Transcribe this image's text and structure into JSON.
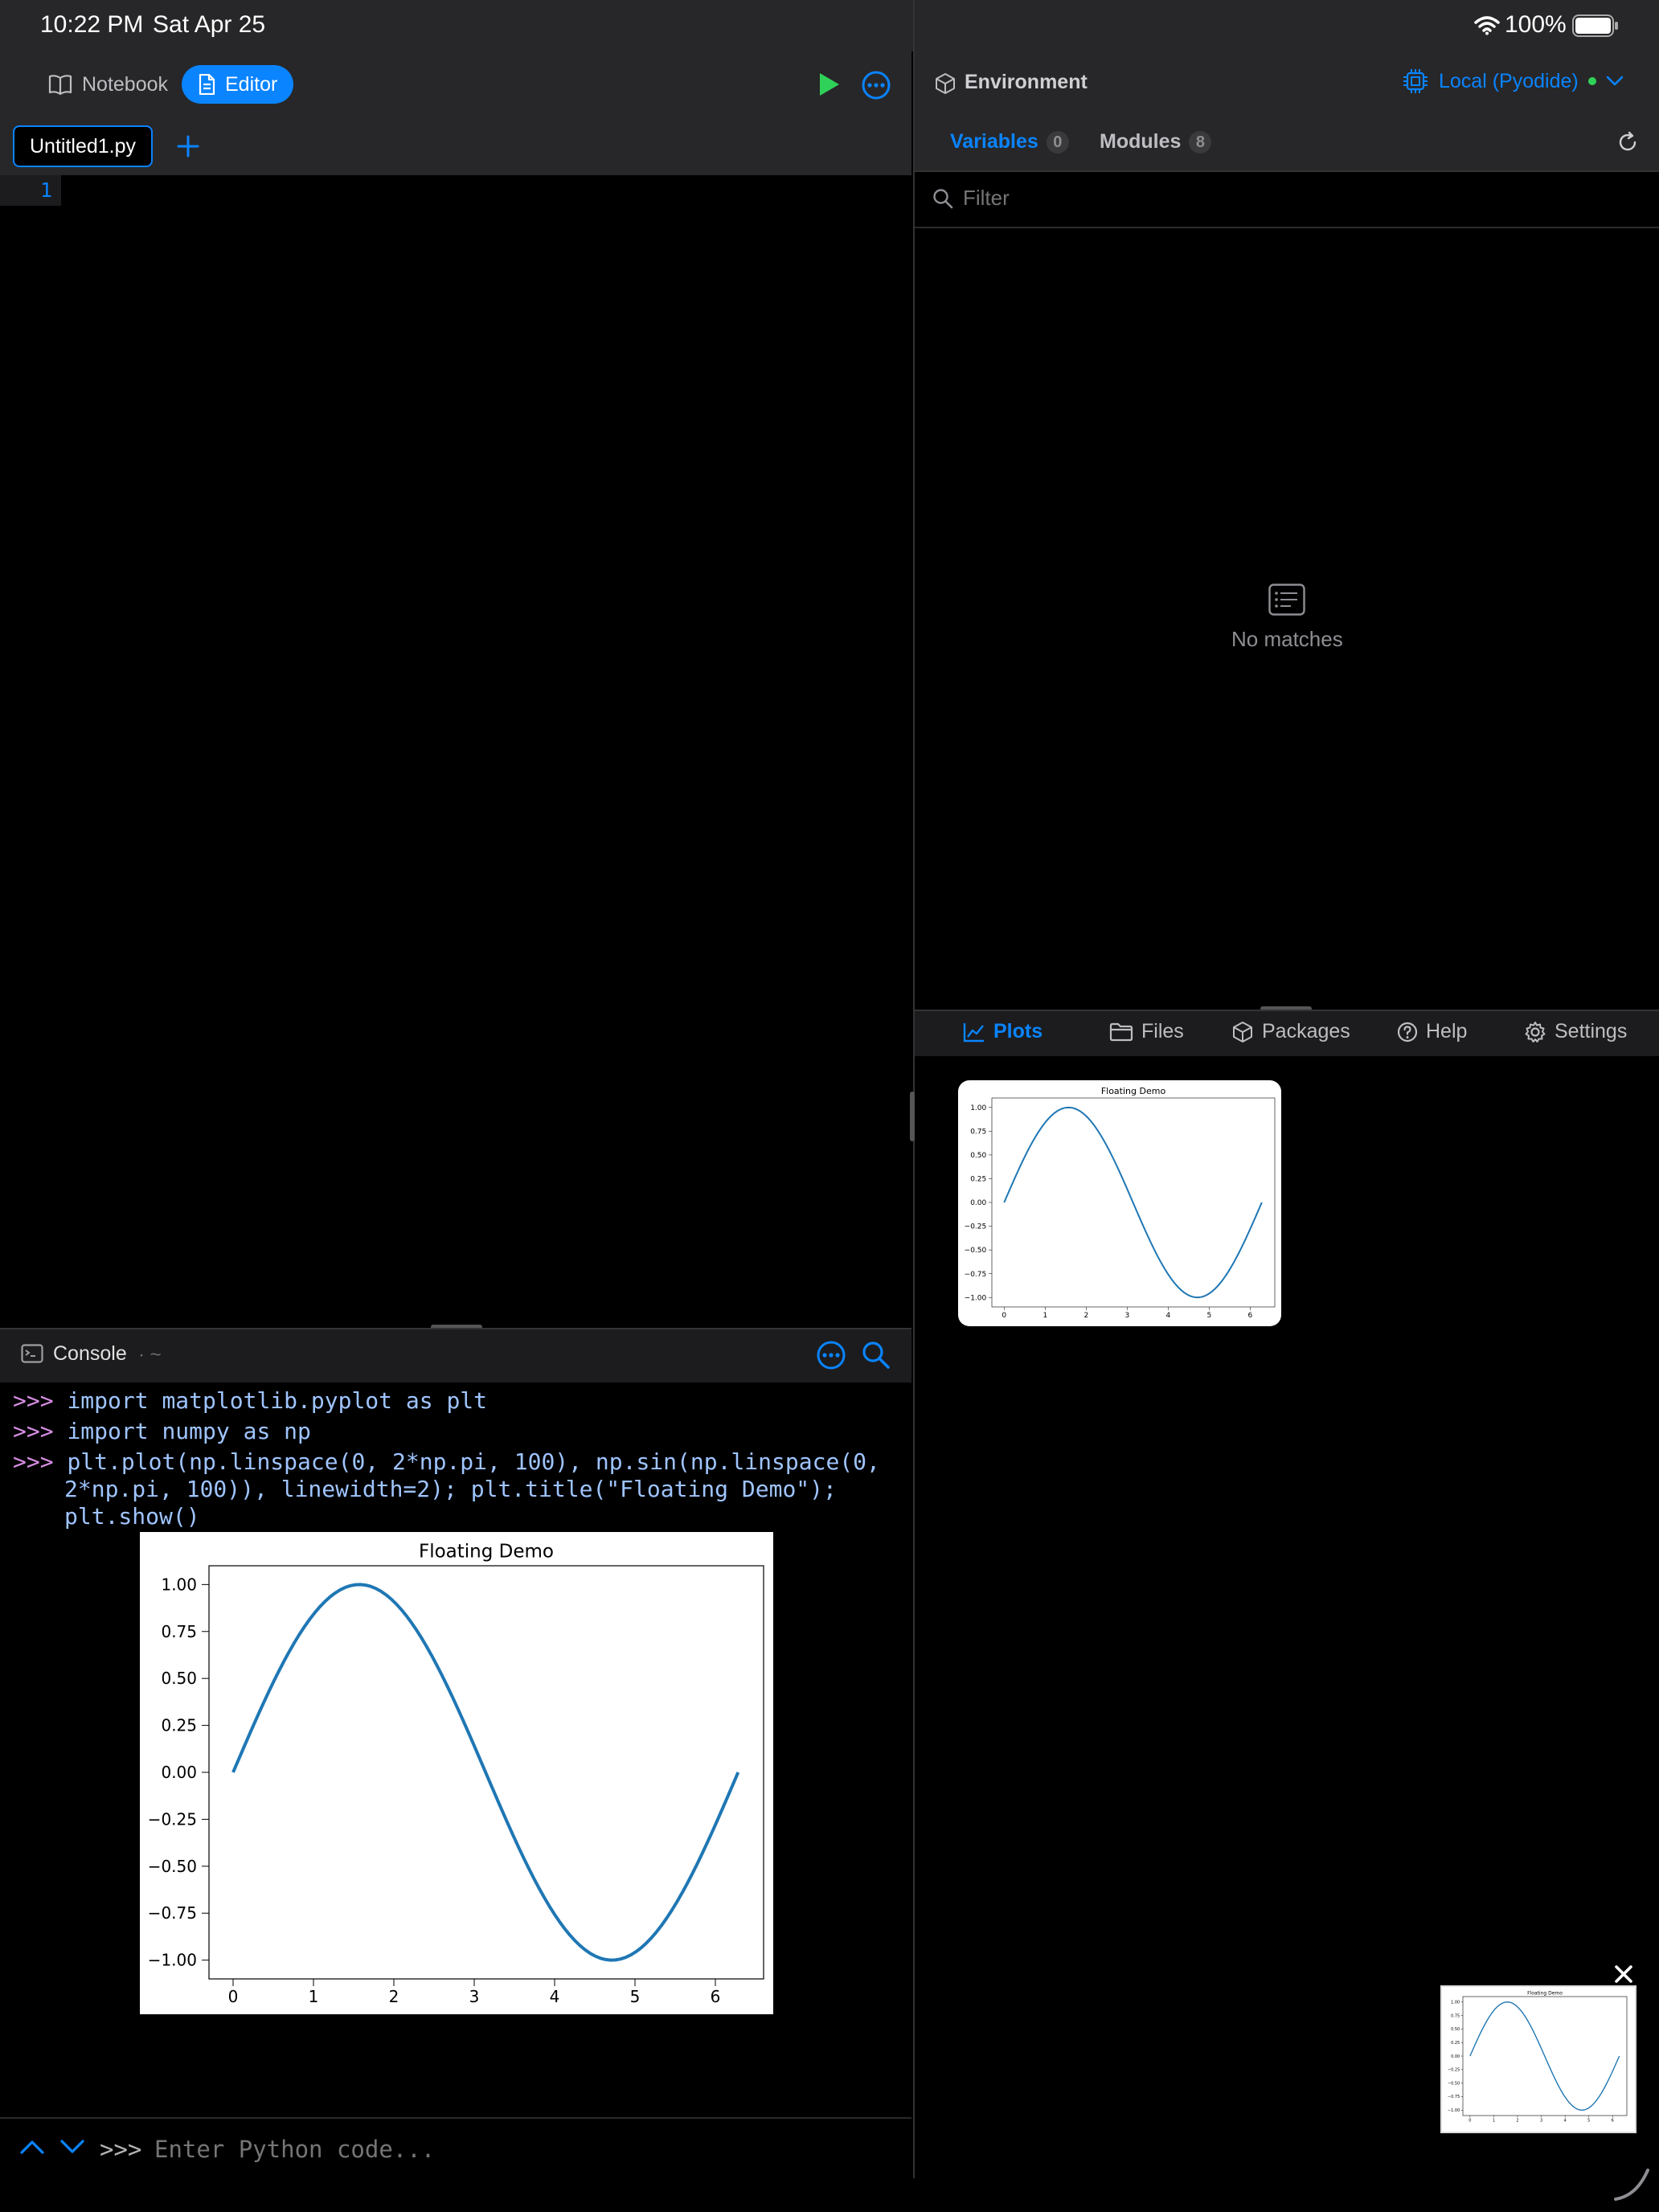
{
  "status": {
    "time": "10:22 PM",
    "date": "Sat Apr 25",
    "battery": "100%"
  },
  "toolbar": {
    "notebook_label": "Notebook",
    "editor_label": "Editor",
    "file_tab": "Untitled1.py"
  },
  "editor": {
    "line_number": "1"
  },
  "env": {
    "title": "Environment",
    "runtime": "Local (Pyodide)",
    "tabs": [
      {
        "label": "Variables",
        "count": "0"
      },
      {
        "label": "Modules",
        "count": "8"
      }
    ],
    "filter_placeholder": "Filter",
    "empty_text": "No matches"
  },
  "bottom_tabs": [
    {
      "label": "Plots"
    },
    {
      "label": "Files"
    },
    {
      "label": "Packages"
    },
    {
      "label": "Help"
    },
    {
      "label": "Settings"
    }
  ],
  "console": {
    "title": "Console",
    "cwd": "· ~",
    "prompt": ">>>",
    "lines": [
      "import matplotlib.pyplot as plt",
      "import numpy as np",
      "plt.plot(np.linspace(0, 2*np.pi, 100), np.sin(np.linspace(0,",
      "2*np.pi, 100)), linewidth=2); plt.title(\"Floating Demo\");",
      "plt.show()"
    ],
    "input_prompt": ">>>",
    "input_placeholder": "Enter Python code..."
  },
  "colors": {
    "accent": "#0a84ff",
    "run": "#30d158",
    "prompt": "#d98ee6",
    "code": "#9fc4ff",
    "line": "#1f77b4"
  },
  "chart_data": [
    {
      "type": "line",
      "title": "Floating Demo",
      "x_ticks": [
        "0",
        "1",
        "2",
        "3",
        "4",
        "5",
        "6"
      ],
      "y_ticks": [
        "1.00",
        "0.75",
        "0.50",
        "0.25",
        "0.00",
        "−0.25",
        "−0.50",
        "−0.75",
        "−1.00"
      ],
      "xlim": [
        -0.3,
        6.6
      ],
      "ylim": [
        -1.1,
        1.1
      ],
      "series": [
        {
          "function": "sin",
          "x_range": [
            0,
            6.2832
          ],
          "n_points": 100,
          "linewidth": 2
        }
      ]
    }
  ]
}
